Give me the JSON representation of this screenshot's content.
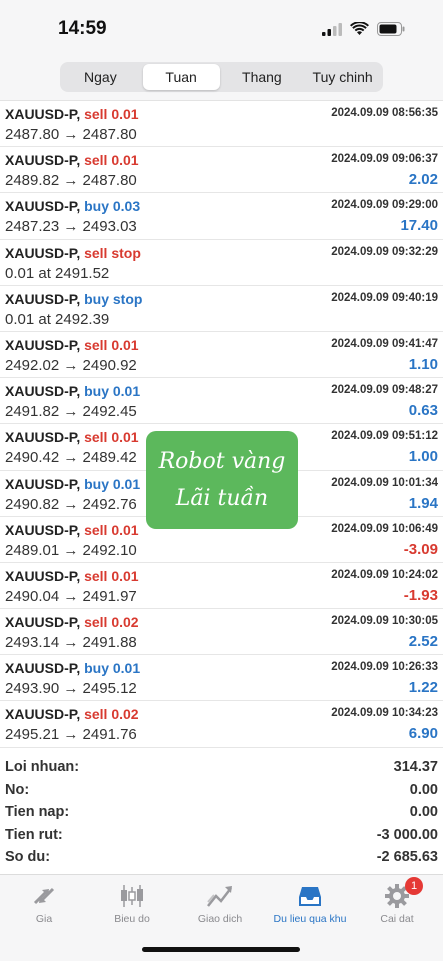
{
  "status": {
    "time": "14:59"
  },
  "segments": [
    "Ngay",
    "Tuan",
    "Thang",
    "Tuy chinh"
  ],
  "active_segment": 1,
  "orders": [
    {
      "symbol": "XAUUSD-P,",
      "side": "sell",
      "side_text": "sell 0.01",
      "prices": "2487.80 → 2487.80",
      "datetime": "2024.09.09 08:56:35",
      "profit": "",
      "profit_sign": ""
    },
    {
      "symbol": "XAUUSD-P,",
      "side": "sell",
      "side_text": "sell 0.01",
      "prices": "2489.82 → 2487.80",
      "datetime": "2024.09.09 09:06:37",
      "profit": "2.02",
      "profit_sign": "pos"
    },
    {
      "symbol": "XAUUSD-P,",
      "side": "buy",
      "side_text": "buy 0.03",
      "prices": "2487.23 → 2493.03",
      "datetime": "2024.09.09 09:29:00",
      "profit": "17.40",
      "profit_sign": "pos"
    },
    {
      "symbol": "XAUUSD-P,",
      "side": "sell",
      "side_text": "sell stop",
      "prices": "0.01 at 2491.52",
      "datetime": "2024.09.09 09:32:29",
      "profit": "",
      "profit_sign": ""
    },
    {
      "symbol": "XAUUSD-P,",
      "side": "buy",
      "side_text": "buy stop",
      "prices": "0.01 at 2492.39",
      "datetime": "2024.09.09 09:40:19",
      "profit": "",
      "profit_sign": ""
    },
    {
      "symbol": "XAUUSD-P,",
      "side": "sell",
      "side_text": "sell 0.01",
      "prices": "2492.02 → 2490.92",
      "datetime": "2024.09.09 09:41:47",
      "profit": "1.10",
      "profit_sign": "pos"
    },
    {
      "symbol": "XAUUSD-P,",
      "side": "buy",
      "side_text": "buy 0.01",
      "prices": "2491.82 → 2492.45",
      "datetime": "2024.09.09 09:48:27",
      "profit": "0.63",
      "profit_sign": "pos"
    },
    {
      "symbol": "XAUUSD-P,",
      "side": "sell",
      "side_text": "sell 0.01",
      "prices": "2490.42 → 2489.42",
      "datetime": "2024.09.09 09:51:12",
      "profit": "1.00",
      "profit_sign": "pos"
    },
    {
      "symbol": "XAUUSD-P,",
      "side": "buy",
      "side_text": "buy 0.01",
      "prices": "2490.82 → 2492.76",
      "datetime": "2024.09.09 10:01:34",
      "profit": "1.94",
      "profit_sign": "pos"
    },
    {
      "symbol": "XAUUSD-P,",
      "side": "sell",
      "side_text": "sell 0.01",
      "prices": "2489.01 → 2492.10",
      "datetime": "2024.09.09 10:06:49",
      "profit": "-3.09",
      "profit_sign": "neg"
    },
    {
      "symbol": "XAUUSD-P,",
      "side": "sell",
      "side_text": "sell 0.01",
      "prices": "2490.04 → 2491.97",
      "datetime": "2024.09.09 10:24:02",
      "profit": "-1.93",
      "profit_sign": "neg"
    },
    {
      "symbol": "XAUUSD-P,",
      "side": "sell",
      "side_text": "sell 0.02",
      "prices": "2493.14 → 2491.88",
      "datetime": "2024.09.09 10:30:05",
      "profit": "2.52",
      "profit_sign": "pos"
    },
    {
      "symbol": "XAUUSD-P,",
      "side": "buy",
      "side_text": "buy 0.01",
      "prices": "2493.90 → 2495.12",
      "datetime": "2024.09.09 10:26:33",
      "profit": "1.22",
      "profit_sign": "pos"
    },
    {
      "symbol": "XAUUSD-P,",
      "side": "sell",
      "side_text": "sell 0.02",
      "prices": "2495.21 → 2491.76",
      "datetime": "2024.09.09 10:34:23",
      "profit": "6.90",
      "profit_sign": "pos"
    }
  ],
  "summary": [
    {
      "label": "Loi nhuan:",
      "value": "314.37"
    },
    {
      "label": "No:",
      "value": "0.00"
    },
    {
      "label": "Tien nap:",
      "value": "0.00"
    },
    {
      "label": "Tien rut:",
      "value": "-3 000.00"
    },
    {
      "label": "So du:",
      "value": "-2 685.63"
    }
  ],
  "badge": {
    "line1": "Robot vàng",
    "line2": "Lãi tuần",
    "color": "#5cb85c"
  },
  "tabs": [
    {
      "label": "Gia",
      "icon": "price-arrows-icon"
    },
    {
      "label": "Bieu do",
      "icon": "candlestick-chart-icon"
    },
    {
      "label": "Giao dich",
      "icon": "trade-chart-icon"
    },
    {
      "label": "Du lieu qua khu",
      "icon": "history-inbox-icon"
    },
    {
      "label": "Cai dat",
      "icon": "gear-icon",
      "badge": "1"
    }
  ],
  "active_tab": 3,
  "colors": {
    "sell": "#d83a30",
    "buy": "#2a75c5",
    "active_tab": "#2a75c5"
  }
}
